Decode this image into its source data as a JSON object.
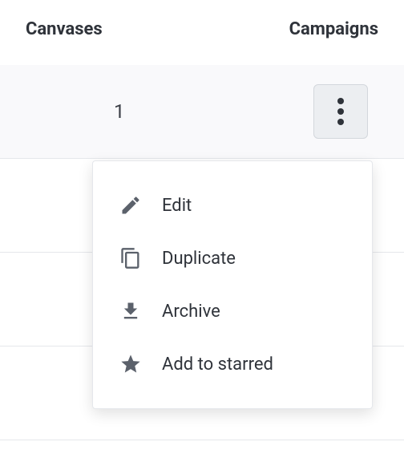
{
  "header": {
    "canvases_label": "Canvases",
    "campaigns_label": "Campaigns"
  },
  "rows": {
    "first_count": "1"
  },
  "dropdown": {
    "items": [
      {
        "label": "Edit",
        "icon": "pencil-icon"
      },
      {
        "label": "Duplicate",
        "icon": "copy-icon"
      },
      {
        "label": "Archive",
        "icon": "archive-icon"
      },
      {
        "label": "Add to starred",
        "icon": "star-icon"
      }
    ]
  }
}
